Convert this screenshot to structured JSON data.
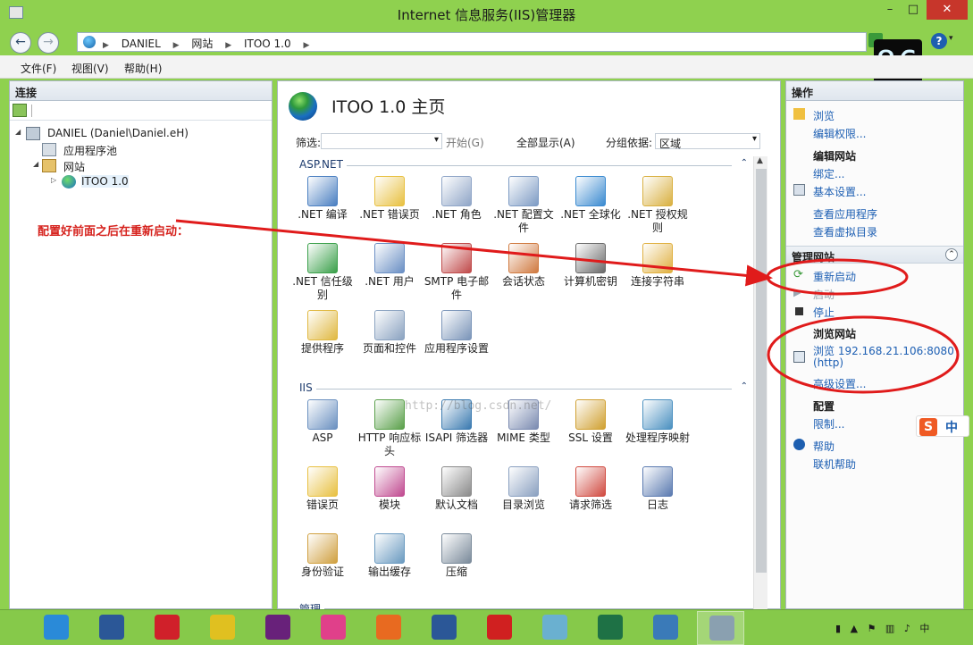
{
  "window": {
    "title": "Internet 信息服务(IIS)管理器",
    "min_glyph": "–",
    "max_glyph": "□",
    "close_glyph": "✕"
  },
  "address": {
    "back_glyph": "←",
    "forward_glyph": "→",
    "crumbs": [
      "DANIEL",
      "网站",
      "ITOO 1.0"
    ],
    "sep_glyph": "▶"
  },
  "help_glyph": "?",
  "help_drop_glyph": "▾",
  "counter": "86",
  "menu": {
    "file": "文件(F)",
    "view": "视图(V)",
    "help": "帮助(H)"
  },
  "left_pane": {
    "title": "连接",
    "tree": [
      {
        "label": "DANIEL (Daniel\\Daniel.eH)",
        "icon": "server-icon",
        "expander": "◢"
      },
      {
        "label": "应用程序池",
        "icon": "app-pool-icon",
        "expander": ""
      },
      {
        "label": "网站",
        "icon": "sites-folder-icon",
        "expander": "◢"
      },
      {
        "label": "ITOO 1.0",
        "icon": "site-globe-icon",
        "expander": "▷"
      }
    ]
  },
  "center_pane": {
    "title": "ITOO 1.0 主页",
    "filter": {
      "label": "筛选:",
      "start": "开始(G)",
      "show_all": "全部显示(A)",
      "group_by": "分组依据:",
      "group_value": "区域"
    },
    "sections": [
      {
        "name": "ASP.NET",
        "collapse_glyph": "⌃",
        "items": [
          {
            "label": ".NET 编译",
            "icon": "net-compile-icon",
            "color": "#4a7fc1"
          },
          {
            "label": ".NET 错误页",
            "icon": "net-error-page-icon",
            "color": "#e8c040"
          },
          {
            "label": ".NET 角色",
            "icon": "net-roles-icon",
            "color": "#8fa5c7"
          },
          {
            "label": ".NET 配置文件",
            "icon": "net-profile-icon",
            "color": "#7d9bc4"
          },
          {
            "label": ".NET 全球化",
            "icon": "net-globalization-icon",
            "color": "#3a8ad0"
          },
          {
            "label": ".NET 授权规则",
            "icon": "net-authorization-icon",
            "color": "#d9b040"
          },
          {
            "label": ".NET 信任级别",
            "icon": "net-trust-levels-icon",
            "color": "#3aa04a"
          },
          {
            "label": ".NET 用户",
            "icon": "net-users-icon",
            "color": "#6a8fc4"
          },
          {
            "label": "SMTP 电子邮件",
            "icon": "smtp-email-icon",
            "color": "#c04a4a"
          },
          {
            "label": "会话状态",
            "icon": "session-state-icon",
            "color": "#d07a40"
          },
          {
            "label": "计算机密钥",
            "icon": "machine-key-icon",
            "color": "#6a6a6a"
          },
          {
            "label": "连接字符串",
            "icon": "connection-strings-icon",
            "color": "#e0b040"
          },
          {
            "label": "提供程序",
            "icon": "providers-icon",
            "color": "#e0b840"
          },
          {
            "label": "页面和控件",
            "icon": "pages-controls-icon",
            "color": "#8aa2c0"
          },
          {
            "label": "应用程序设置",
            "icon": "app-settings-icon",
            "color": "#7a94b8"
          }
        ]
      },
      {
        "name": "IIS",
        "collapse_glyph": "⌃",
        "items": [
          {
            "label": "ASP",
            "icon": "asp-icon",
            "color": "#6a90c0"
          },
          {
            "label": "HTTP 响应标头",
            "icon": "http-headers-icon",
            "color": "#5aa04a"
          },
          {
            "label": "ISAPI 筛选器",
            "icon": "isapi-filters-icon",
            "color": "#3a7ab0"
          },
          {
            "label": "MIME 类型",
            "icon": "mime-types-icon",
            "color": "#7a8ab0"
          },
          {
            "label": "SSL 设置",
            "icon": "ssl-lock-icon",
            "color": "#d0a030"
          },
          {
            "label": "处理程序映射",
            "icon": "handler-mappings-icon",
            "color": "#4a90c0"
          },
          {
            "label": "错误页",
            "icon": "error-pages-icon",
            "color": "#e8c040"
          },
          {
            "label": "模块",
            "icon": "modules-icon",
            "color": "#c04a90"
          },
          {
            "label": "默认文档",
            "icon": "default-document-icon",
            "color": "#8a8a8a"
          },
          {
            "label": "目录浏览",
            "icon": "directory-browsing-icon",
            "color": "#8aa0c0"
          },
          {
            "label": "请求筛选",
            "icon": "request-filtering-icon",
            "color": "#d04a40"
          },
          {
            "label": "日志",
            "icon": "logging-icon",
            "color": "#5a7ab0"
          },
          {
            "label": "身份验证",
            "icon": "authentication-icon",
            "color": "#d0a040"
          },
          {
            "label": "输出缓存",
            "icon": "output-caching-icon",
            "color": "#6a9ac0"
          },
          {
            "label": "压缩",
            "icon": "compression-icon",
            "color": "#7a8a9a"
          }
        ]
      },
      {
        "name": "管理",
        "collapse_glyph": "",
        "items": []
      }
    ],
    "watermark": "http://blog.csdn.net/"
  },
  "right_pane": {
    "title": "操作",
    "browse": "浏览",
    "edit_permissions": "编辑权限...",
    "edit_site_head": "编辑网站",
    "bindings": "绑定...",
    "basic_settings": "基本设置...",
    "view_apps": "查看应用程序",
    "view_vdirs": "查看虚拟目录",
    "manage_site_head": "管理网站",
    "collapse_glyph": "⌃",
    "restart": "重新启动",
    "start": "启动",
    "stop": "停止",
    "browse_site_head": "浏览网站",
    "browse_url": "浏览 192.168.21.106:8080",
    "browse_proto": "(http)",
    "advanced_settings": "高级设置...",
    "config_head": "配置",
    "limits": "限制...",
    "help": "帮助",
    "online_help": "联机帮助"
  },
  "annotation": "配置好前面之后在重新启动：",
  "ime": {
    "s": "S",
    "zh": "中"
  },
  "taskbar": {
    "apps": [
      {
        "icon": "onedrive-icon",
        "color": "#2a8ad8"
      },
      {
        "icon": "word-icon",
        "color": "#2b5797"
      },
      {
        "icon": "xmind-icon",
        "color": "#d0202a"
      },
      {
        "icon": "tool-icon",
        "color": "#e0c020"
      },
      {
        "icon": "visual-studio-icon",
        "color": "#68217a"
      },
      {
        "icon": "app-pink-icon",
        "color": "#e0408a"
      },
      {
        "icon": "firefox-icon",
        "color": "#e86a20"
      },
      {
        "icon": "word-doc-icon",
        "color": "#2b5797"
      },
      {
        "icon": "dots-app-icon",
        "color": "#d02020"
      },
      {
        "icon": "notes-icon",
        "color": "#6ab0d0"
      },
      {
        "icon": "excel-icon",
        "color": "#1e7145"
      },
      {
        "icon": "remote-desktop-icon",
        "color": "#3a7ab8"
      },
      {
        "icon": "iis-manager-icon",
        "color": "#8aa0b0"
      }
    ]
  }
}
